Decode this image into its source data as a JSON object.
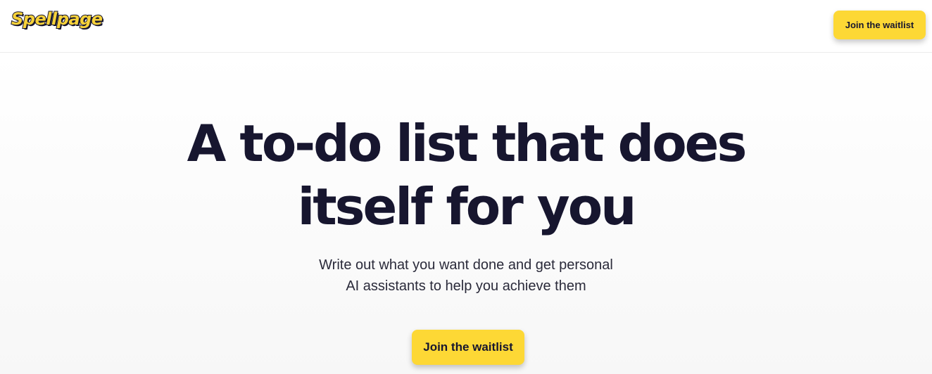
{
  "header": {
    "logo_text": "Spellpage",
    "cta_label": "Join the waitlist"
  },
  "hero": {
    "headline_line1": "A to-do list that does",
    "headline_line2": "itself for you",
    "subtext_line1": "Write out what you want done and get personal",
    "subtext_line2": "AI assistants to help you achieve them",
    "cta_label": "Join the waitlist"
  },
  "colors": {
    "accent": "#fdd835",
    "text_dark": "#17162f"
  }
}
